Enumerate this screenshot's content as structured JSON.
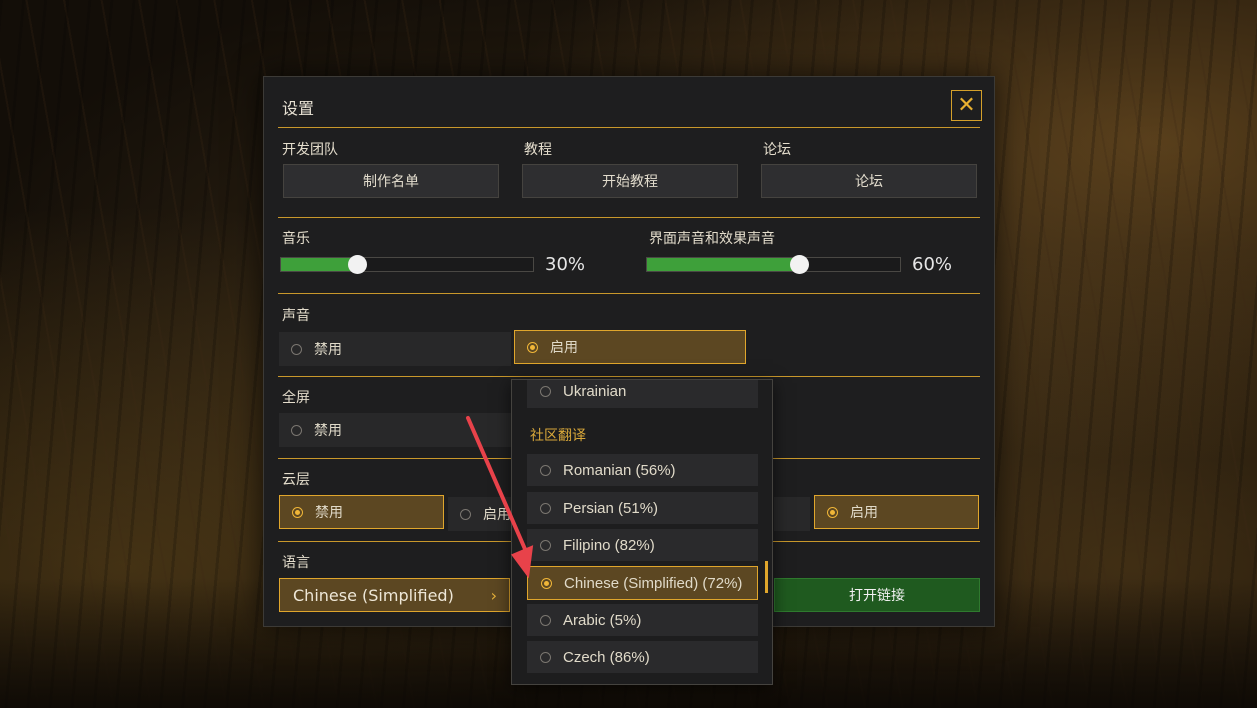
{
  "settings": {
    "title": "设置",
    "close_glyph": "✕",
    "team": {
      "label": "开发团队",
      "button": "制作名单"
    },
    "tutorial": {
      "label": "教程",
      "button": "开始教程"
    },
    "forum": {
      "label": "论坛",
      "button": "论坛"
    },
    "music": {
      "label": "音乐",
      "value": 30,
      "display": "30%"
    },
    "ui_sound": {
      "label": "界面声音和效果声音",
      "value": 60,
      "display": "60%"
    },
    "sound": {
      "label": "声音",
      "options": [
        "禁用",
        "启用"
      ],
      "selected": "启用"
    },
    "fullscreen": {
      "label": "全屏",
      "options": [
        "禁用"
      ],
      "selected": ""
    },
    "clouds": {
      "label": "云层",
      "options": [
        "禁用",
        "启用"
      ],
      "selected": "禁用"
    },
    "cloud_right": {
      "option": "启用"
    },
    "language": {
      "label": "语言",
      "value": "Chinese (Simplified)",
      "chevron": "›"
    },
    "open_link": "打开链接"
  },
  "dropdown": {
    "partial_item": "Ukrainian",
    "section_title": "社区翻译",
    "items": [
      "Romanian (56%)",
      "Persian (51%)",
      "Filipino  (82%)",
      "Chinese (Simplified) (72%)",
      "Arabic (5%)",
      "Czech (86%)"
    ],
    "selected": "Chinese (Simplified) (72%)"
  },
  "colors": {
    "accent": "#e0a62c",
    "slider_fill": "#3ea03a",
    "annotation_arrow": "#e8424a"
  }
}
